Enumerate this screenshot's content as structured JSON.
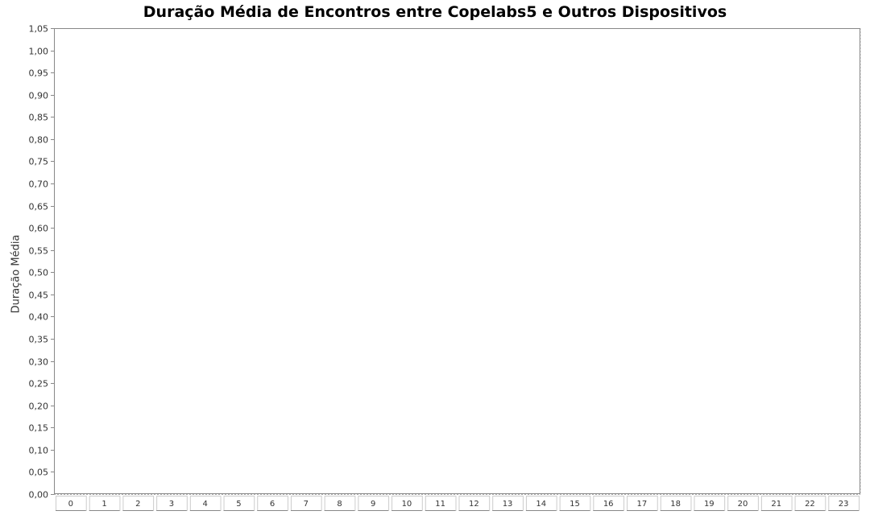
{
  "chart_data": {
    "type": "bar",
    "title": "Duração Média de Encontros entre Copelabs5 e Outros Dispositivos",
    "xlabel": "",
    "ylabel": "Duração Média",
    "categories": [
      "0",
      "1",
      "2",
      "3",
      "4",
      "5",
      "6",
      "7",
      "8",
      "9",
      "10",
      "11",
      "12",
      "13",
      "14",
      "15",
      "16",
      "17",
      "18",
      "19",
      "20",
      "21",
      "22",
      "23"
    ],
    "series": [
      {
        "values": [
          0,
          0,
          0,
          0,
          0,
          0,
          0,
          0,
          0,
          0,
          0,
          0,
          0,
          0,
          0,
          0,
          0,
          0,
          0,
          0,
          0,
          0,
          0,
          0
        ]
      }
    ],
    "ylim": [
      0,
      1.05
    ],
    "ytick_labels": [
      "0,00",
      "0,05",
      "0,10",
      "0,15",
      "0,20",
      "0,25",
      "0,30",
      "0,35",
      "0,40",
      "0,45",
      "0,50",
      "0,55",
      "0,60",
      "0,65",
      "0,70",
      "0,75",
      "0,80",
      "0,85",
      "0,90",
      "0,95",
      "1,00",
      "1,05"
    ],
    "grid": true,
    "colors": {
      "axis": "#888888",
      "grid_major": "#aaaaaa",
      "grid_minor": "#dddddd",
      "text": "#333333"
    }
  }
}
